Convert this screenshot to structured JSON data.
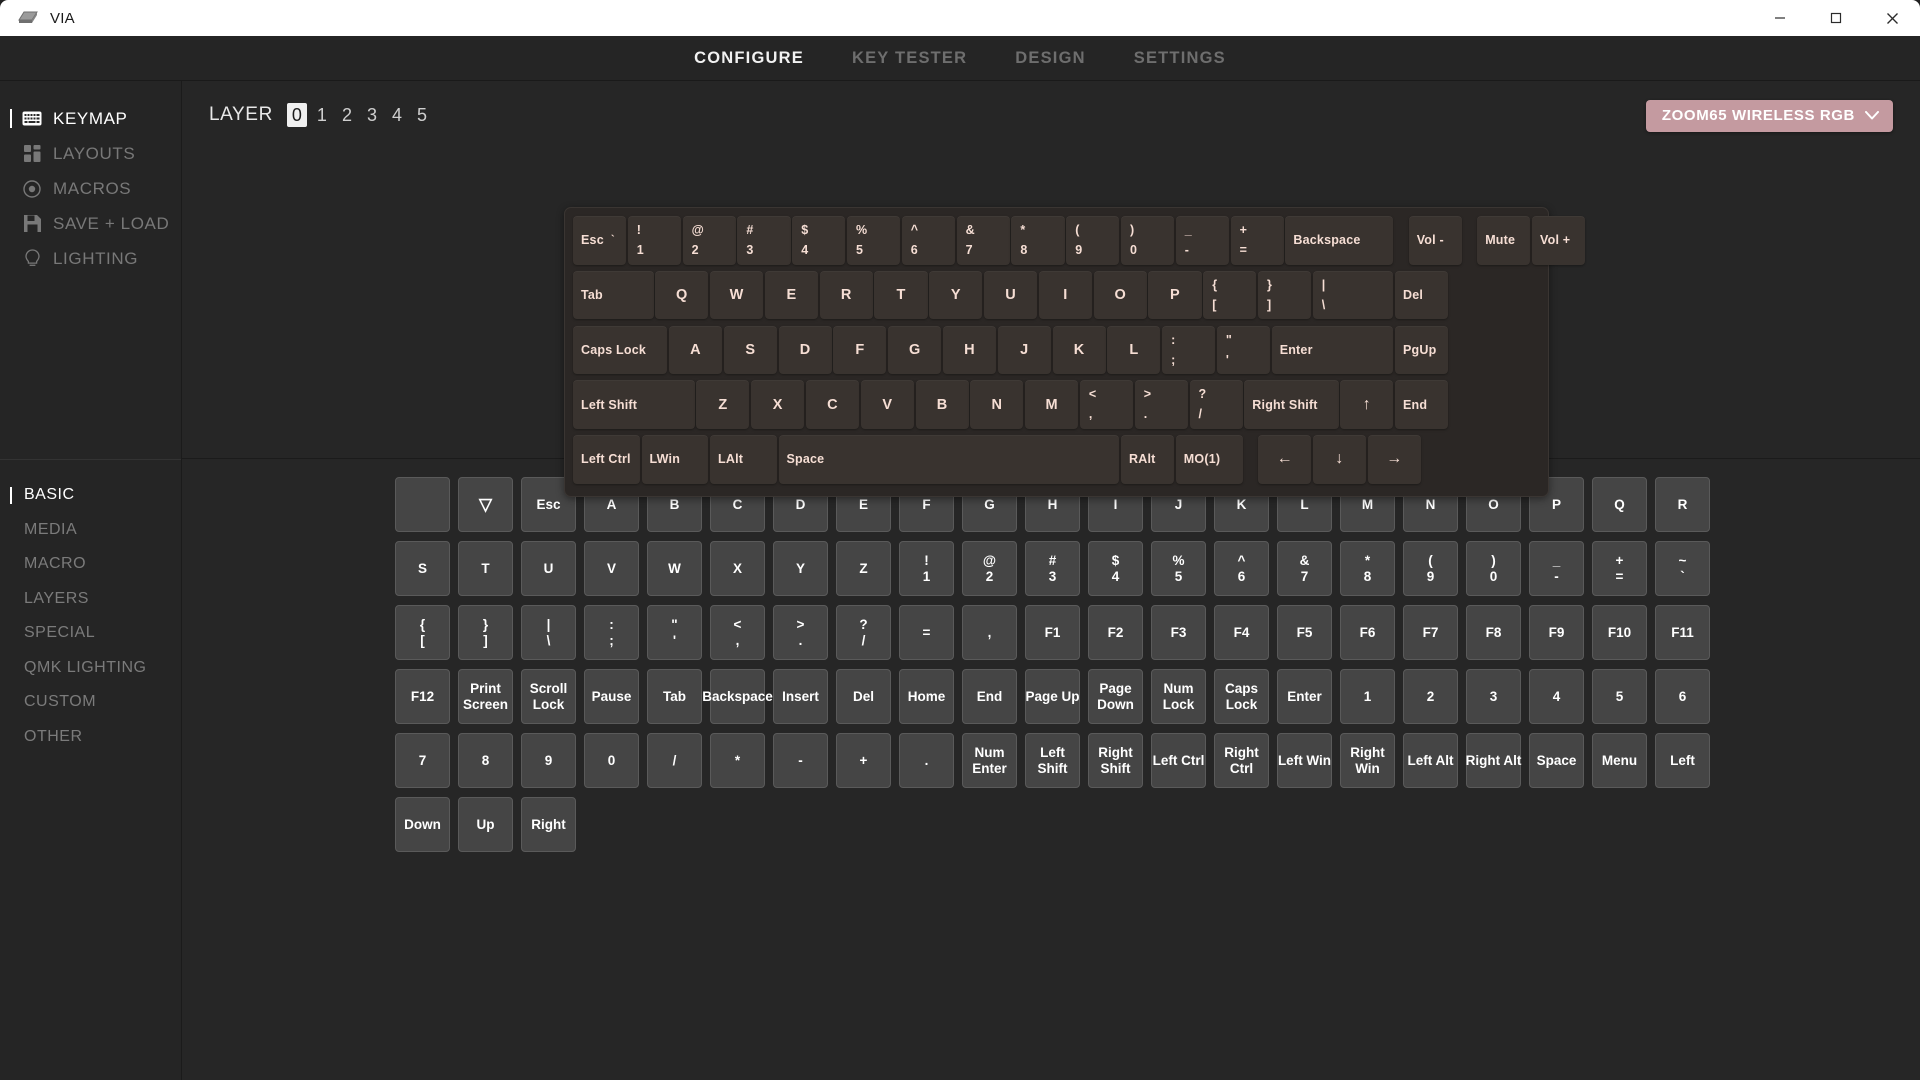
{
  "window": {
    "title": "VIA",
    "logo_icon": "keyboard-icon",
    "minimize_icon": "minimize-icon",
    "maximize_icon": "maximize-icon",
    "close_icon": "close-icon"
  },
  "nav": {
    "tabs": [
      {
        "label": "CONFIGURE",
        "active": true
      },
      {
        "label": "KEY TESTER",
        "active": false
      },
      {
        "label": "DESIGN",
        "active": false
      },
      {
        "label": "SETTINGS",
        "active": false
      }
    ]
  },
  "sidebar": {
    "top": [
      {
        "label": "KEYMAP",
        "icon": "keyboard-icon",
        "active": true
      },
      {
        "label": "LAYOUTS",
        "icon": "layouts-grid-icon",
        "active": false
      },
      {
        "label": "MACROS",
        "icon": "record-dot-icon",
        "active": false
      },
      {
        "label": "SAVE + LOAD",
        "icon": "floppy-disk-icon",
        "active": false
      },
      {
        "label": "LIGHTING",
        "icon": "lightbulb-icon",
        "active": false
      }
    ],
    "bottom": [
      {
        "label": "BASIC",
        "active": true
      },
      {
        "label": "MEDIA",
        "active": false
      },
      {
        "label": "MACRO",
        "active": false
      },
      {
        "label": "LAYERS",
        "active": false
      },
      {
        "label": "SPECIAL",
        "active": false
      },
      {
        "label": "QMK LIGHTING",
        "active": false
      },
      {
        "label": "CUSTOM",
        "active": false
      },
      {
        "label": "OTHER",
        "active": false
      }
    ]
  },
  "layers": {
    "label": "LAYER",
    "options": [
      "0",
      "1",
      "2",
      "3",
      "4",
      "5"
    ],
    "selected": "0"
  },
  "keyboard_select": {
    "label": "ZOOM65 WIRELESS RGB",
    "chevron_icon": "chevron-down-icon",
    "color": "#c49aa0"
  },
  "keymap": {
    "rows": [
      [
        {
          "label": "Esc",
          "sub": "`",
          "w": 1.0,
          "style": "left-esc"
        },
        {
          "top": "!",
          "bot": "1",
          "w": 1.0,
          "style": "dual"
        },
        {
          "top": "@",
          "bot": "2",
          "w": 1.0,
          "style": "dual"
        },
        {
          "top": "#",
          "bot": "3",
          "w": 1.0,
          "style": "dual"
        },
        {
          "top": "$",
          "bot": "4",
          "w": 1.0,
          "style": "dual"
        },
        {
          "top": "%",
          "bot": "5",
          "w": 1.0,
          "style": "dual"
        },
        {
          "top": "^",
          "bot": "6",
          "w": 1.0,
          "style": "dual"
        },
        {
          "top": "&",
          "bot": "7",
          "w": 1.0,
          "style": "dual"
        },
        {
          "top": "*",
          "bot": "8",
          "w": 1.0,
          "style": "dual"
        },
        {
          "top": "(",
          "bot": "9",
          "w": 1.0,
          "style": "dual"
        },
        {
          "top": ")",
          "bot": "0",
          "w": 1.0,
          "style": "dual"
        },
        {
          "top": "_",
          "bot": "-",
          "w": 1.0,
          "style": "dual"
        },
        {
          "top": "+",
          "bot": "=",
          "w": 1.0,
          "style": "dual"
        },
        {
          "label": "Backspace",
          "w": 2.0,
          "style": "left"
        },
        {
          "label": "Vol -",
          "w": 1.0,
          "style": "left",
          "gap": 0.25
        },
        {
          "label": "Mute",
          "w": 1.0,
          "style": "left",
          "gap": 0.25
        },
        {
          "label": "Vol +",
          "w": 1.0,
          "style": "left"
        }
      ],
      [
        {
          "label": "Tab",
          "w": 1.5,
          "style": "left"
        },
        {
          "label": "Q",
          "w": 1.0,
          "style": "center"
        },
        {
          "label": "W",
          "w": 1.0,
          "style": "center"
        },
        {
          "label": "E",
          "w": 1.0,
          "style": "center"
        },
        {
          "label": "R",
          "w": 1.0,
          "style": "center"
        },
        {
          "label": "T",
          "w": 1.0,
          "style": "center"
        },
        {
          "label": "Y",
          "w": 1.0,
          "style": "center"
        },
        {
          "label": "U",
          "w": 1.0,
          "style": "center"
        },
        {
          "label": "I",
          "w": 1.0,
          "style": "center"
        },
        {
          "label": "O",
          "w": 1.0,
          "style": "center"
        },
        {
          "label": "P",
          "w": 1.0,
          "style": "center"
        },
        {
          "top": "{",
          "bot": "[",
          "w": 1.0,
          "style": "dual"
        },
        {
          "top": "}",
          "bot": "]",
          "w": 1.0,
          "style": "dual"
        },
        {
          "top": "|",
          "bot": "\\",
          "w": 1.5,
          "style": "dual"
        },
        {
          "label": "Del",
          "w": 1.0,
          "style": "left"
        }
      ],
      [
        {
          "label": "Caps Lock",
          "w": 1.75,
          "style": "left"
        },
        {
          "label": "A",
          "w": 1.0,
          "style": "center"
        },
        {
          "label": "S",
          "w": 1.0,
          "style": "center"
        },
        {
          "label": "D",
          "w": 1.0,
          "style": "center"
        },
        {
          "label": "F",
          "w": 1.0,
          "style": "center"
        },
        {
          "label": "G",
          "w": 1.0,
          "style": "center"
        },
        {
          "label": "H",
          "w": 1.0,
          "style": "center"
        },
        {
          "label": "J",
          "w": 1.0,
          "style": "center"
        },
        {
          "label": "K",
          "w": 1.0,
          "style": "center"
        },
        {
          "label": "L",
          "w": 1.0,
          "style": "center"
        },
        {
          "top": ":",
          "bot": ";",
          "w": 1.0,
          "style": "dual"
        },
        {
          "top": "\"",
          "bot": "'",
          "w": 1.0,
          "style": "dual"
        },
        {
          "label": "Enter",
          "w": 2.25,
          "style": "left"
        },
        {
          "label": "PgUp",
          "w": 1.0,
          "style": "left"
        }
      ],
      [
        {
          "label": "Left Shift",
          "w": 2.25,
          "style": "left"
        },
        {
          "label": "Z",
          "w": 1.0,
          "style": "center"
        },
        {
          "label": "X",
          "w": 1.0,
          "style": "center"
        },
        {
          "label": "C",
          "w": 1.0,
          "style": "center"
        },
        {
          "label": "V",
          "w": 1.0,
          "style": "center"
        },
        {
          "label": "B",
          "w": 1.0,
          "style": "center"
        },
        {
          "label": "N",
          "w": 1.0,
          "style": "center"
        },
        {
          "label": "M",
          "w": 1.0,
          "style": "center"
        },
        {
          "top": "<",
          "bot": ",",
          "w": 1.0,
          "style": "dual"
        },
        {
          "top": ">",
          "bot": ".",
          "w": 1.0,
          "style": "dual"
        },
        {
          "top": "?",
          "bot": "/",
          "w": 1.0,
          "style": "dual"
        },
        {
          "label": "Right Shift",
          "w": 1.75,
          "style": "left"
        },
        {
          "label": "↑",
          "w": 1.0,
          "style": "arrow"
        },
        {
          "label": "End",
          "w": 1.0,
          "style": "left"
        }
      ],
      [
        {
          "label": "Left Ctrl",
          "w": 1.25,
          "style": "left"
        },
        {
          "label": "LWin",
          "w": 1.25,
          "style": "left"
        },
        {
          "label": "LAlt",
          "w": 1.25,
          "style": "left"
        },
        {
          "label": "Space",
          "w": 6.25,
          "style": "left"
        },
        {
          "label": "RAlt",
          "w": 1.0,
          "style": "left"
        },
        {
          "label": "MO(1)",
          "w": 1.25,
          "style": "left"
        },
        {
          "label": "←",
          "w": 1.0,
          "style": "arrow",
          "gap": 0.25
        },
        {
          "label": "↓",
          "w": 1.0,
          "style": "arrow"
        },
        {
          "label": "→",
          "w": 1.0,
          "style": "arrow"
        }
      ]
    ]
  },
  "key_picker": {
    "rows": [
      [
        {
          "label": ""
        },
        {
          "label": "▽",
          "icon": "triangle-down-icon"
        },
        {
          "label": "Esc"
        },
        {
          "label": "A"
        },
        {
          "label": "B"
        },
        {
          "label": "C"
        },
        {
          "label": "D"
        },
        {
          "label": "E"
        },
        {
          "label": "F"
        },
        {
          "label": "G"
        },
        {
          "label": "H"
        },
        {
          "label": "I"
        },
        {
          "label": "J"
        },
        {
          "label": "K"
        },
        {
          "label": "L"
        },
        {
          "label": "M"
        },
        {
          "label": "N"
        },
        {
          "label": "O"
        },
        {
          "label": "P"
        },
        {
          "label": "Q"
        },
        {
          "label": "R"
        }
      ],
      [
        {
          "label": "S"
        },
        {
          "label": "T"
        },
        {
          "label": "U"
        },
        {
          "label": "V"
        },
        {
          "label": "W"
        },
        {
          "label": "X"
        },
        {
          "label": "Y"
        },
        {
          "label": "Z"
        },
        {
          "l1": "!",
          "l2": "1"
        },
        {
          "l1": "@",
          "l2": "2"
        },
        {
          "l1": "#",
          "l2": "3"
        },
        {
          "l1": "$",
          "l2": "4"
        },
        {
          "l1": "%",
          "l2": "5"
        },
        {
          "l1": "^",
          "l2": "6"
        },
        {
          "l1": "&",
          "l2": "7"
        },
        {
          "l1": "*",
          "l2": "8"
        },
        {
          "l1": "(",
          "l2": "9"
        },
        {
          "l1": ")",
          "l2": "0"
        },
        {
          "l1": "_",
          "l2": "-"
        },
        {
          "l1": "+",
          "l2": "="
        },
        {
          "l1": "~",
          "l2": "`"
        }
      ],
      [
        {
          "l1": "{",
          "l2": "["
        },
        {
          "l1": "}",
          "l2": "]"
        },
        {
          "l1": "|",
          "l2": "\\"
        },
        {
          "l1": ":",
          "l2": ";"
        },
        {
          "l1": "\"",
          "l2": "'"
        },
        {
          "l1": "<",
          "l2": ","
        },
        {
          "l1": ">",
          "l2": "."
        },
        {
          "l1": "?",
          "l2": "/"
        },
        {
          "label": "="
        },
        {
          "label": ","
        },
        {
          "label": "F1"
        },
        {
          "label": "F2"
        },
        {
          "label": "F3"
        },
        {
          "label": "F4"
        },
        {
          "label": "F5"
        },
        {
          "label": "F6"
        },
        {
          "label": "F7"
        },
        {
          "label": "F8"
        },
        {
          "label": "F9"
        },
        {
          "label": "F10"
        },
        {
          "label": "F11"
        }
      ],
      [
        {
          "label": "F12"
        },
        {
          "l1": "Print",
          "l2": "Screen"
        },
        {
          "l1": "Scroll",
          "l2": "Lock"
        },
        {
          "label": "Pause"
        },
        {
          "label": "Tab"
        },
        {
          "label": "Backspace"
        },
        {
          "label": "Insert"
        },
        {
          "label": "Del"
        },
        {
          "label": "Home"
        },
        {
          "label": "End"
        },
        {
          "label": "Page Up"
        },
        {
          "l1": "Page",
          "l2": "Down"
        },
        {
          "l1": "Num",
          "l2": "Lock"
        },
        {
          "l1": "Caps",
          "l2": "Lock"
        },
        {
          "label": "Enter"
        },
        {
          "label": "1"
        },
        {
          "label": "2"
        },
        {
          "label": "3"
        },
        {
          "label": "4"
        },
        {
          "label": "5"
        },
        {
          "label": "6"
        }
      ],
      [
        {
          "label": "7"
        },
        {
          "label": "8"
        },
        {
          "label": "9"
        },
        {
          "label": "0"
        },
        {
          "label": "/"
        },
        {
          "label": "*"
        },
        {
          "label": "-"
        },
        {
          "label": "+"
        },
        {
          "label": "."
        },
        {
          "l1": "Num",
          "l2": "Enter"
        },
        {
          "l1": "Left",
          "l2": "Shift"
        },
        {
          "l1": "Right",
          "l2": "Shift"
        },
        {
          "label": "Left Ctrl"
        },
        {
          "l1": "Right",
          "l2": "Ctrl"
        },
        {
          "label": "Left Win"
        },
        {
          "l1": "Right",
          "l2": "Win"
        },
        {
          "label": "Left Alt"
        },
        {
          "label": "Right Alt"
        },
        {
          "label": "Space"
        },
        {
          "label": "Menu"
        },
        {
          "label": "Left"
        }
      ],
      [
        {
          "label": "Down"
        },
        {
          "label": "Up"
        },
        {
          "label": "Right"
        }
      ]
    ]
  }
}
